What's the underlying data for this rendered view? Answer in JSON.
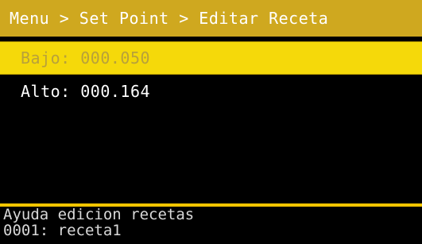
{
  "header": {
    "breadcrumb": "Menu > Set Point > Editar Receta"
  },
  "list": {
    "items": [
      {
        "label": "Bajo: 000.050",
        "selected": true
      },
      {
        "label": "Alto: 000.164",
        "selected": false
      }
    ]
  },
  "footer": {
    "help_text": "Ayuda edicion recetas",
    "recipe_text": "0001: receta1"
  },
  "colors": {
    "header_bg": "#cfa81f",
    "selected_bg": "#f5d90a",
    "divider": "#f2c500",
    "background": "#000000"
  }
}
